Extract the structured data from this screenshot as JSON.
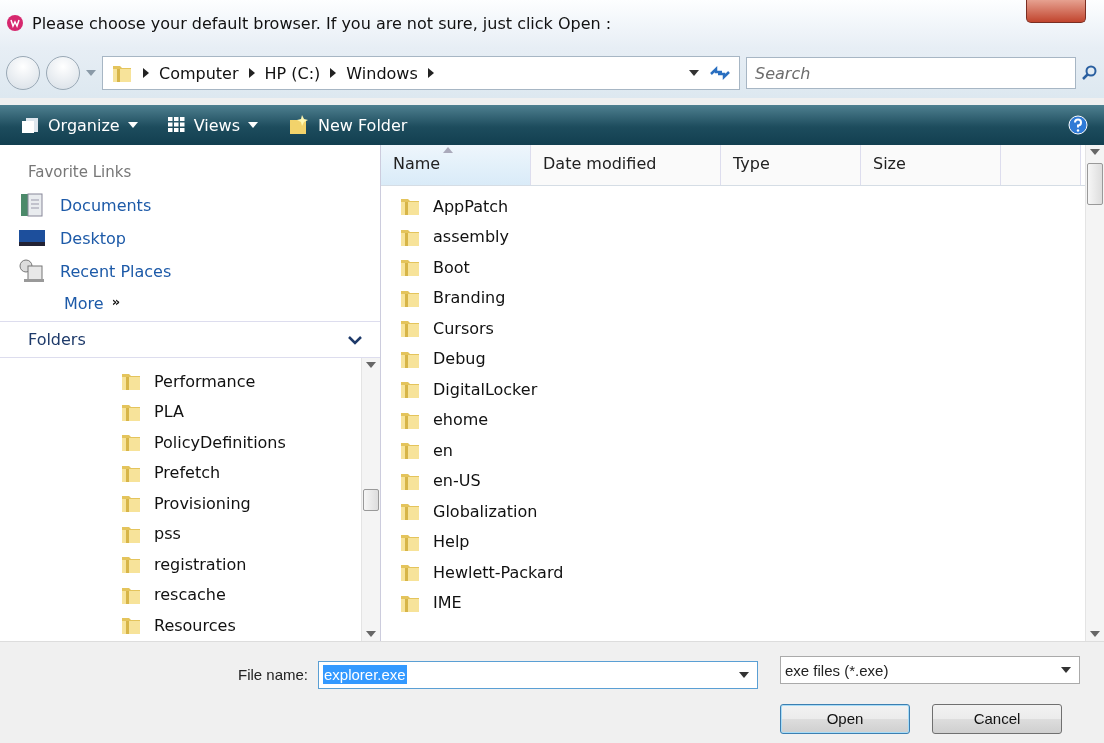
{
  "window": {
    "title": "Please choose your default browser. If you are not sure, just click Open :"
  },
  "address_bar": {
    "path": [
      "Computer",
      "HP (C:)",
      "Windows"
    ],
    "search": {
      "placeholder": "Search"
    }
  },
  "toolbar": {
    "items": [
      {
        "kind": "menu",
        "label": "Organize"
      },
      {
        "kind": "menu",
        "label": "Views"
      },
      {
        "kind": "action",
        "label": "New Folder"
      }
    ]
  },
  "favorite_links": {
    "title": "Favorite Links",
    "items": [
      {
        "kind": "documents",
        "label": "Documents"
      },
      {
        "kind": "desktop",
        "label": "Desktop"
      },
      {
        "kind": "recent",
        "label": "Recent Places"
      }
    ],
    "more": "More",
    "more_glyph": "»"
  },
  "folders": {
    "title": "Folders",
    "expanded": true,
    "items": [
      "Performance",
      "PLA",
      "PolicyDefinitions",
      "Prefetch",
      "Provisioning",
      "pss",
      "registration",
      "rescache",
      "Resources"
    ]
  },
  "table": {
    "columns": [
      {
        "label": "Name",
        "sorted": true
      },
      {
        "label": "Date modified",
        "sorted": false
      },
      {
        "label": "Type",
        "sorted": false
      },
      {
        "label": "Size",
        "sorted": false
      }
    ],
    "rows": [
      "AppPatch",
      "assembly",
      "Boot",
      "Branding",
      "Cursors",
      "Debug",
      "DigitalLocker",
      "ehome",
      "en",
      "en-US",
      "Globalization",
      "Help",
      "Hewlett-Packard",
      "IME"
    ]
  },
  "file_name": {
    "label": "File name:",
    "value": "explorer.exe",
    "text_selected": true
  },
  "file_type": {
    "value": "exe files (*.exe)"
  },
  "buttons": [
    {
      "label": "Open",
      "default": true
    },
    {
      "label": "Cancel",
      "default": false
    }
  ]
}
